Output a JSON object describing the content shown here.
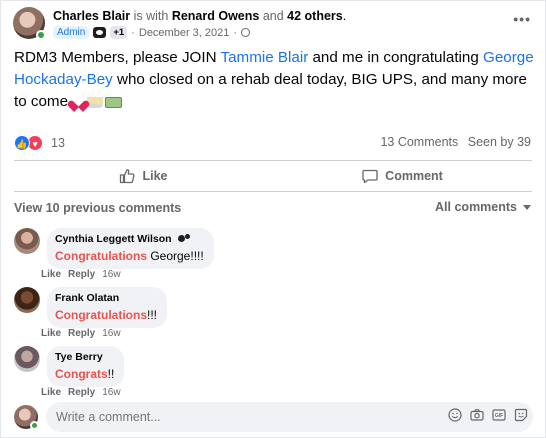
{
  "header": {
    "author": "Charles Blair",
    "is_with": " is with ",
    "with_name": "Renard Owens",
    "and_text": " and ",
    "others": "42 others",
    "period": ".",
    "admin_badge": "Admin",
    "plus_badge": "+1",
    "dot": "·",
    "date": "December 3, 2021",
    "more": "•••"
  },
  "post": {
    "text_1": "RDM3 Members, please JOIN ",
    "mention_1": "Tammie Blair",
    "text_2": " and me in congratulating ",
    "mention_2": "George Hockaday-Bey",
    "text_3": " who closed on a rehab deal today, BIG UPS, and many more to come "
  },
  "reactions": {
    "count": "13",
    "comments": "13 Comments",
    "seen": "Seen by 39"
  },
  "actions": {
    "like": "Like",
    "comment": "Comment"
  },
  "comments_section": {
    "view_previous": "View 10 previous comments",
    "sort": "All comments"
  },
  "comments": [
    {
      "name": "Cynthia Leggett Wilson",
      "tag": "Congratulations",
      "text": " George!!!!",
      "like": "Like",
      "reply": "Reply",
      "time": "16w"
    },
    {
      "name": "Frank Olatan",
      "tag": "Congratulations",
      "text": "!!!",
      "like": "Like",
      "reply": "Reply",
      "time": "16w"
    },
    {
      "name": "Tye Berry",
      "tag": "Congrats",
      "text": "!!",
      "like": "Like",
      "reply": "Reply",
      "time": "16w"
    }
  ],
  "composer": {
    "placeholder": "Write a comment..."
  },
  "colors": {
    "accent": "#1b74e4",
    "tag": "#e8554e",
    "online": "#31a24c"
  }
}
